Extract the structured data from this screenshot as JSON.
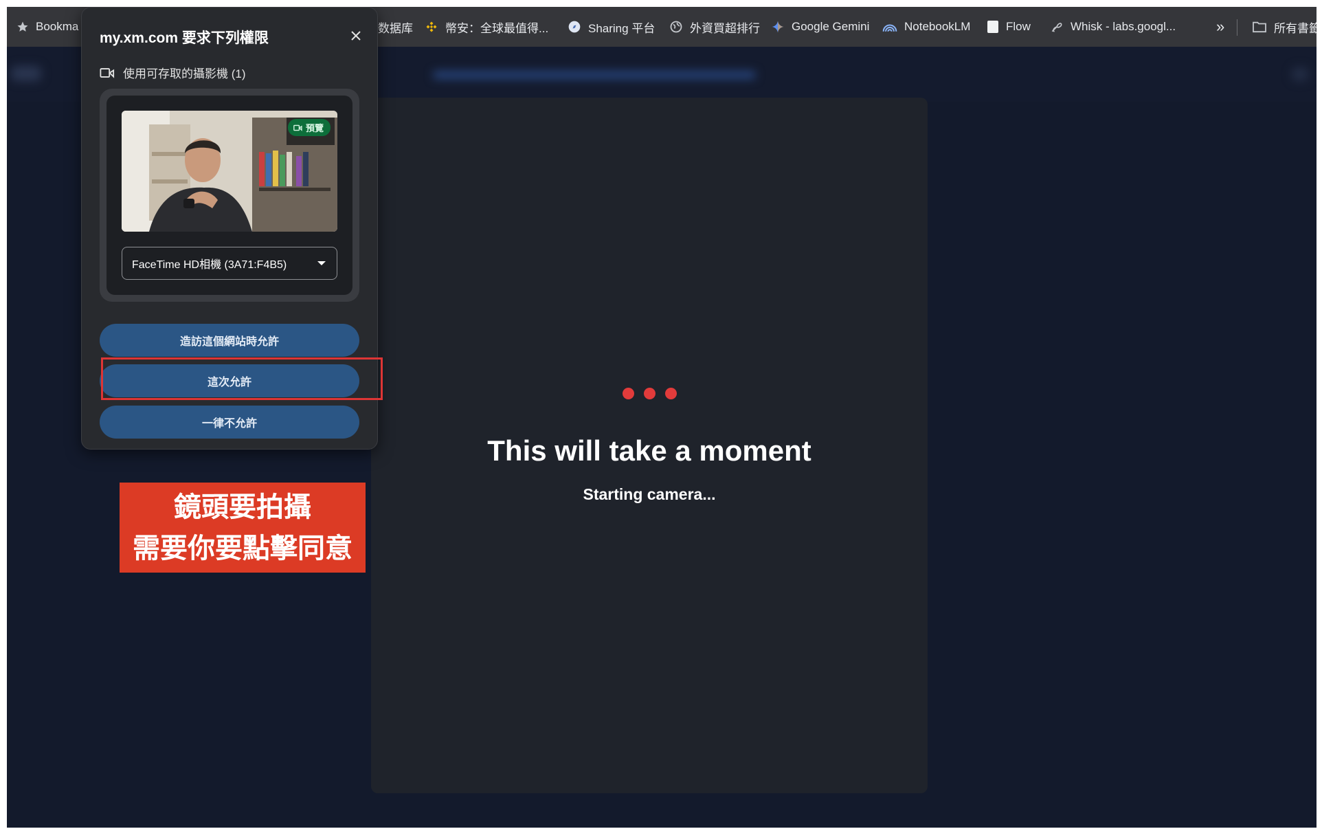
{
  "bookmarks": [
    {
      "label": "Bookma",
      "icon": "star-icon"
    },
    {
      "label": "数据库",
      "icon": ""
    },
    {
      "label": "幣安：全球最值得...",
      "icon": "binance-icon"
    },
    {
      "label": "Sharing 平台",
      "icon": "compass-icon"
    },
    {
      "label": "外資買超排行",
      "icon": "globe-icon"
    },
    {
      "label": "Google Gemini",
      "icon": "gemini-icon"
    },
    {
      "label": "NotebookLM",
      "icon": "notebooklm-icon"
    },
    {
      "label": "Flow",
      "icon": "page-icon"
    },
    {
      "label": "Whisk - labs.googl...",
      "icon": "whisk-icon"
    }
  ],
  "bookmarks_overflow": "»",
  "all_bookmarks_label": "所有書籤",
  "permission": {
    "title": "my.xm.com 要求下列權限",
    "camera_label": "使用可存取的攝影機 (1)",
    "preview_badge": "預覽",
    "camera_select_value": "FaceTime HD相機 (3A71:F4B5)",
    "allow_always": "造訪這個網站時允許",
    "allow_once": "這次允許",
    "never_allow": "一律不允許"
  },
  "loading": {
    "title": "This will take a moment",
    "subtitle": "Starting camera..."
  },
  "annotation": {
    "line1": "鏡頭要拍攝",
    "line2": "需要你要點擊同意"
  },
  "colors": {
    "page_bg": "#131a2c",
    "card_bg": "#1f232b",
    "button_bg": "#2b5685",
    "accent_red": "#e23b3b",
    "annotation_bg": "#dc3b25"
  }
}
